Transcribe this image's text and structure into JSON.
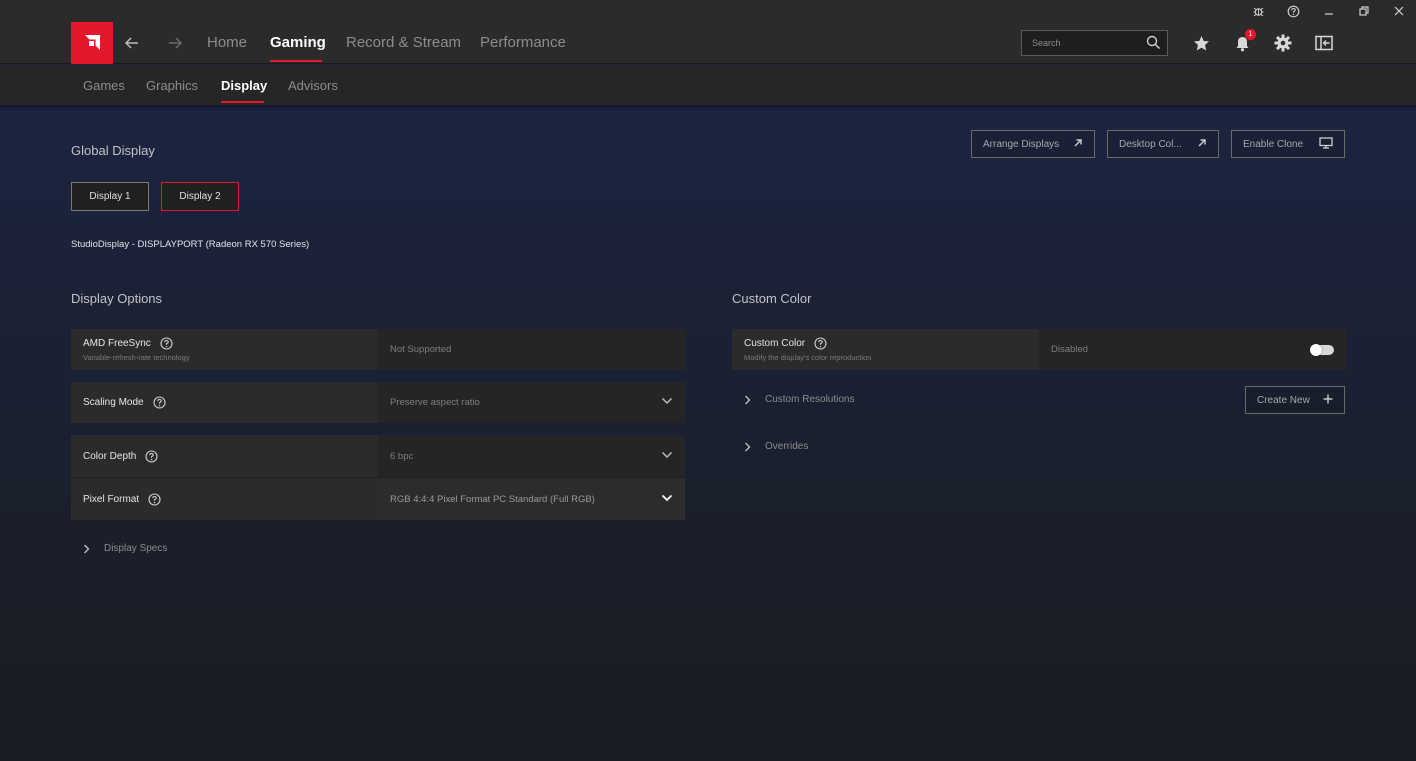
{
  "header": {
    "tabs": [
      {
        "label": "Home"
      },
      {
        "label": "Gaming"
      },
      {
        "label": "Record & Stream"
      },
      {
        "label": "Performance"
      }
    ],
    "search_placeholder": "Search",
    "notification_count": "1"
  },
  "subnav": {
    "tabs": [
      {
        "label": "Games"
      },
      {
        "label": "Graphics"
      },
      {
        "label": "Display"
      },
      {
        "label": "Advisors"
      }
    ]
  },
  "global_display": {
    "title": "Global Display",
    "display_buttons": [
      "Display 1",
      "Display 2"
    ],
    "selected_display": "Display 2",
    "monitor_name": "StudioDisplay - DISPLAYPORT (Radeon RX 570 Series)",
    "actions": {
      "arrange": "Arrange Displays",
      "desktop_color": "Desktop Col...",
      "enable_clone": "Enable Clone"
    }
  },
  "display_options": {
    "title": "Display Options",
    "rows": [
      {
        "label": "AMD FreeSync",
        "sublabel": "Variable-refresh-rate technology",
        "value": "Not Supported"
      },
      {
        "label": "Scaling Mode",
        "value": "Preserve aspect ratio"
      },
      {
        "label": "Color Depth",
        "value": "6 bpc"
      },
      {
        "label": "Pixel Format",
        "value": "RGB 4:4:4 Pixel Format PC Standard (Full RGB)"
      }
    ],
    "display_specs": "Display Specs"
  },
  "custom_color": {
    "title": "Custom Color",
    "row": {
      "label": "Custom Color",
      "sublabel": "Modify the display's color reproduction",
      "value": "Disabled"
    },
    "custom_resolutions": "Custom Resolutions",
    "create_new": "Create New",
    "overrides": "Overrides"
  },
  "colors": {
    "accent": "#e3182b"
  }
}
